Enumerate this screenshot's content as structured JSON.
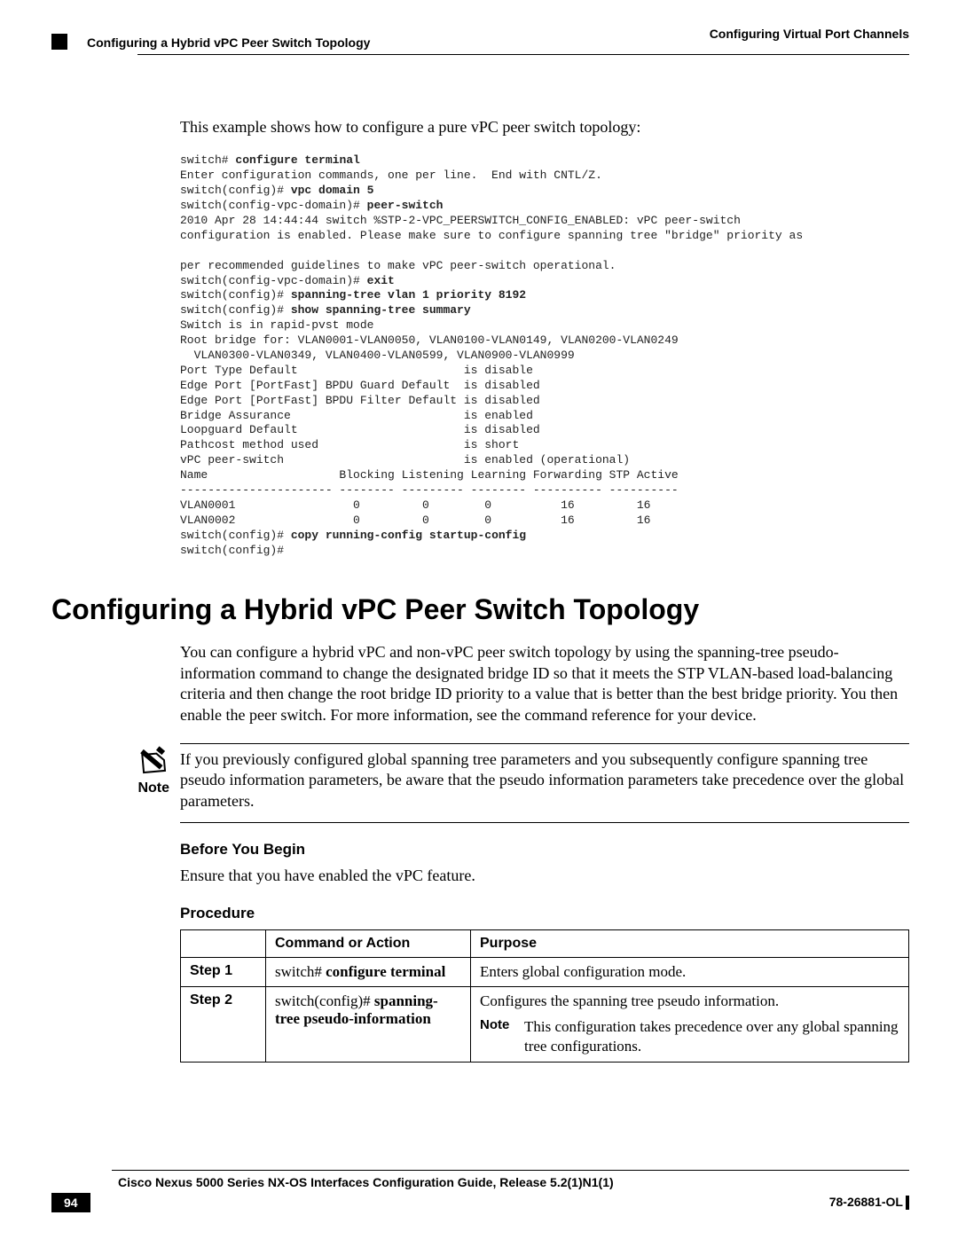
{
  "header": {
    "chapter_title": "Configuring Virtual Port Channels",
    "section_title": "Configuring a Hybrid vPC Peer Switch Topology"
  },
  "intro_paragraph": "This example shows how to configure a pure vPC peer switch topology:",
  "code": {
    "line1_prompt": "switch# ",
    "line1_cmd": "configure terminal",
    "line2": "Enter configuration commands, one per line.  End with CNTL/Z.",
    "line3_prompt": "switch(config)# ",
    "line3_cmd": "vpc domain 5",
    "line4_prompt": "switch(config-vpc-domain)# ",
    "line4_cmd": "peer-switch",
    "line5": "2010 Apr 28 14:44:44 switch %STP-2-VPC_PEERSWITCH_CONFIG_ENABLED: vPC peer-switch",
    "line6": "configuration is enabled. Please make sure to configure spanning tree \"bridge\" priority as",
    "line7": "",
    "line8": "per recommended guidelines to make vPC peer-switch operational.",
    "line9_prompt": "switch(config-vpc-domain)# ",
    "line9_cmd": "exit",
    "line10_prompt": "switch(config)# ",
    "line10_cmd": "spanning-tree vlan 1 priority 8192",
    "line11_prompt": "switch(config)# ",
    "line11_cmd": "show spanning-tree summary",
    "line12": "Switch is in rapid-pvst mode",
    "line13": "Root bridge for: VLAN0001-VLAN0050, VLAN0100-VLAN0149, VLAN0200-VLAN0249",
    "line14": "  VLAN0300-VLAN0349, VLAN0400-VLAN0599, VLAN0900-VLAN0999",
    "line15": "Port Type Default                        is disable",
    "line16": "Edge Port [PortFast] BPDU Guard Default  is disabled",
    "line17": "Edge Port [PortFast] BPDU Filter Default is disabled",
    "line18": "Bridge Assurance                         is enabled",
    "line19": "Loopguard Default                        is disabled",
    "line20": "Pathcost method used                     is short",
    "line21": "vPC peer-switch                          is enabled (operational)",
    "line22": "Name                   Blocking Listening Learning Forwarding STP Active",
    "line23": "---------------------- -------- --------- -------- ---------- ----------",
    "line24": "VLAN0001                 0         0        0          16         16",
    "line25": "VLAN0002                 0         0        0          16         16",
    "line26_prompt": "switch(config)# ",
    "line26_cmd": "copy running-config startup-config",
    "line27": "switch(config)#"
  },
  "section_heading": "Configuring a Hybrid vPC Peer Switch Topology",
  "section_paragraph": "You can configure a hybrid vPC and non-vPC peer switch topology by using the spanning-tree pseudo-information command to change the designated bridge ID so that it meets the STP VLAN-based load-balancing criteria and then change the root bridge ID priority to a value that is better than the best bridge priority. You then enable the peer switch. For more information, see the command reference for your device.",
  "note": {
    "label": "Note",
    "text": "If you previously configured global spanning tree parameters and you subsequently configure spanning tree pseudo information parameters, be aware that the pseudo information parameters take precedence over the global parameters."
  },
  "before_begin": {
    "heading": "Before You Begin",
    "text": "Ensure that you have enabled the vPC feature."
  },
  "procedure": {
    "heading": "Procedure",
    "columns": {
      "step": "",
      "command": "Command or Action",
      "purpose": "Purpose"
    },
    "rows": [
      {
        "step": "Step 1",
        "cmd_prefix": "switch# ",
        "cmd_bold": "configure terminal",
        "purpose": "Enters global configuration mode."
      },
      {
        "step": "Step 2",
        "cmd_prefix": "switch(config)# ",
        "cmd_bold": "spanning-tree pseudo-information",
        "purpose": "Configures the spanning tree pseudo information.",
        "note_label": "Note",
        "note_text": "This configuration takes precedence over any global spanning tree configurations."
      }
    ]
  },
  "footer": {
    "guide_title": "Cisco Nexus 5000 Series NX-OS Interfaces Configuration Guide, Release 5.2(1)N1(1)",
    "page_number": "94",
    "doc_id": "78-26881-OL"
  }
}
